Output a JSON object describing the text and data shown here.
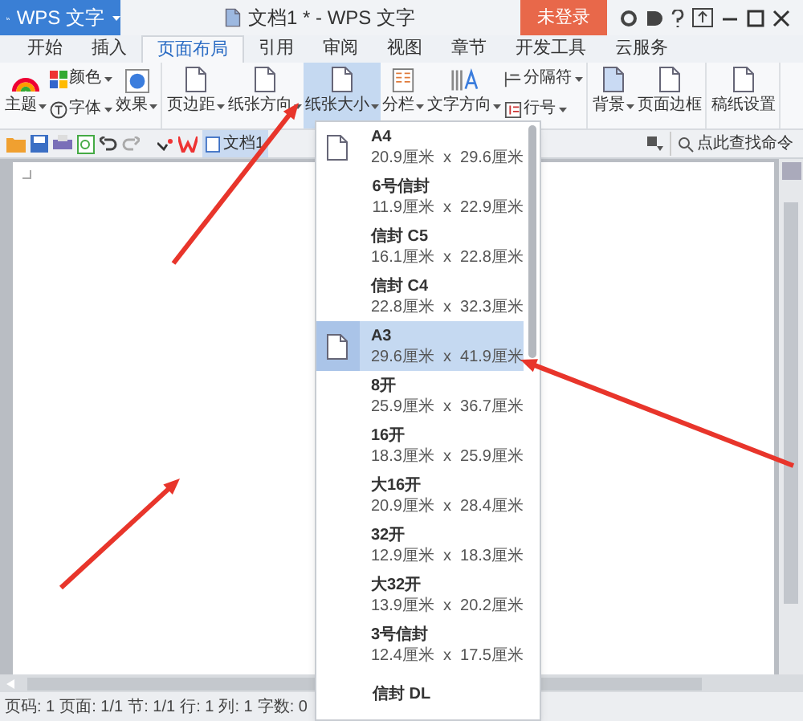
{
  "app_menu": {
    "label": "WPS 文字"
  },
  "window": {
    "title": "文档1 * - WPS 文字"
  },
  "login_button": {
    "label": "未登录"
  },
  "tabs": [
    {
      "label": "开始",
      "selected": false
    },
    {
      "label": "插入",
      "selected": false
    },
    {
      "label": "页面布局",
      "selected": true
    },
    {
      "label": "引用",
      "selected": false
    },
    {
      "label": "审阅",
      "selected": false
    },
    {
      "label": "视图",
      "selected": false
    },
    {
      "label": "章节",
      "selected": false
    },
    {
      "label": "开发工具",
      "selected": false
    },
    {
      "label": "云服务",
      "selected": false
    }
  ],
  "ribbon": [
    {
      "items": [
        {
          "kind": "large",
          "label": "主题",
          "dropdown": true,
          "pressed": false
        },
        {
          "kind": "stack",
          "items": [
            {
              "label": "颜色",
              "dropdown": true,
              "pressed": false
            },
            {
              "label": "字体",
              "dropdown": true,
              "pressed": false
            }
          ]
        },
        {
          "kind": "large",
          "label": "效果",
          "dropdown": true,
          "pressed": false
        }
      ]
    },
    {
      "items": [
        {
          "kind": "large",
          "label": "页边距",
          "dropdown": true,
          "pressed": false
        },
        {
          "kind": "large",
          "label": "纸张方向",
          "dropdown": true,
          "pressed": false
        },
        {
          "kind": "large",
          "label": "纸张大小",
          "dropdown": true,
          "pressed": true
        },
        {
          "kind": "large",
          "label": "分栏",
          "dropdown": true,
          "pressed": false
        },
        {
          "kind": "large",
          "label": "文字方向",
          "dropdown": true,
          "pressed": false
        },
        {
          "kind": "stack",
          "items": [
            {
              "label": "分隔符",
              "dropdown": true,
              "pressed": false
            },
            {
              "label": "行号",
              "dropdown": true,
              "pressed": false
            }
          ]
        }
      ]
    },
    {
      "items": [
        {
          "kind": "large",
          "label": "背景",
          "dropdown": true,
          "pressed": false
        },
        {
          "kind": "large",
          "label": "页面边框",
          "dropdown": false,
          "pressed": false
        }
      ]
    },
    {
      "items": [
        {
          "kind": "large",
          "label": "稿纸设置",
          "dropdown": false,
          "pressed": false
        }
      ]
    }
  ],
  "document_tab": {
    "label": "文档1"
  },
  "search": {
    "placeholder": "点此查找命令"
  },
  "paper_sizes": [
    {
      "kind": "with_icon",
      "name": "A4",
      "size": "20.9厘米  x  29.6厘米",
      "selected": false
    },
    {
      "kind": "plain",
      "name": "6号信封",
      "size": "11.9厘米  x  22.9厘米",
      "selected": false
    },
    {
      "kind": "plain",
      "name": "信封 C5",
      "size": "16.1厘米  x  22.8厘米",
      "selected": false
    },
    {
      "kind": "plain",
      "name": "信封 C4",
      "size": "22.8厘米  x  32.3厘米",
      "selected": false
    },
    {
      "kind": "with_icon",
      "name": "A3",
      "size": "29.6厘米  x  41.9厘米",
      "selected": true
    },
    {
      "kind": "plain",
      "name": "8开",
      "size": "25.9厘米  x  36.7厘米",
      "selected": false
    },
    {
      "kind": "plain",
      "name": "16开",
      "size": "18.3厘米  x  25.9厘米",
      "selected": false
    },
    {
      "kind": "plain",
      "name": "大16开",
      "size": "20.9厘米  x  28.4厘米",
      "selected": false
    },
    {
      "kind": "plain",
      "name": "32开",
      "size": "12.9厘米  x  18.3厘米",
      "selected": false
    },
    {
      "kind": "plain",
      "name": "大32开",
      "size": "13.9厘米  x  20.2厘米",
      "selected": false
    },
    {
      "kind": "plain",
      "name": "3号信封",
      "size": "12.4厘米  x  17.5厘米",
      "selected": false
    },
    {
      "kind": "plain",
      "name": "信封 DL",
      "selected": false
    }
  ],
  "status_bar": [
    "页码: 1",
    "页面: 1/1",
    "节: 1/1",
    "行: 1",
    "列: 1",
    "字数: 0"
  ]
}
